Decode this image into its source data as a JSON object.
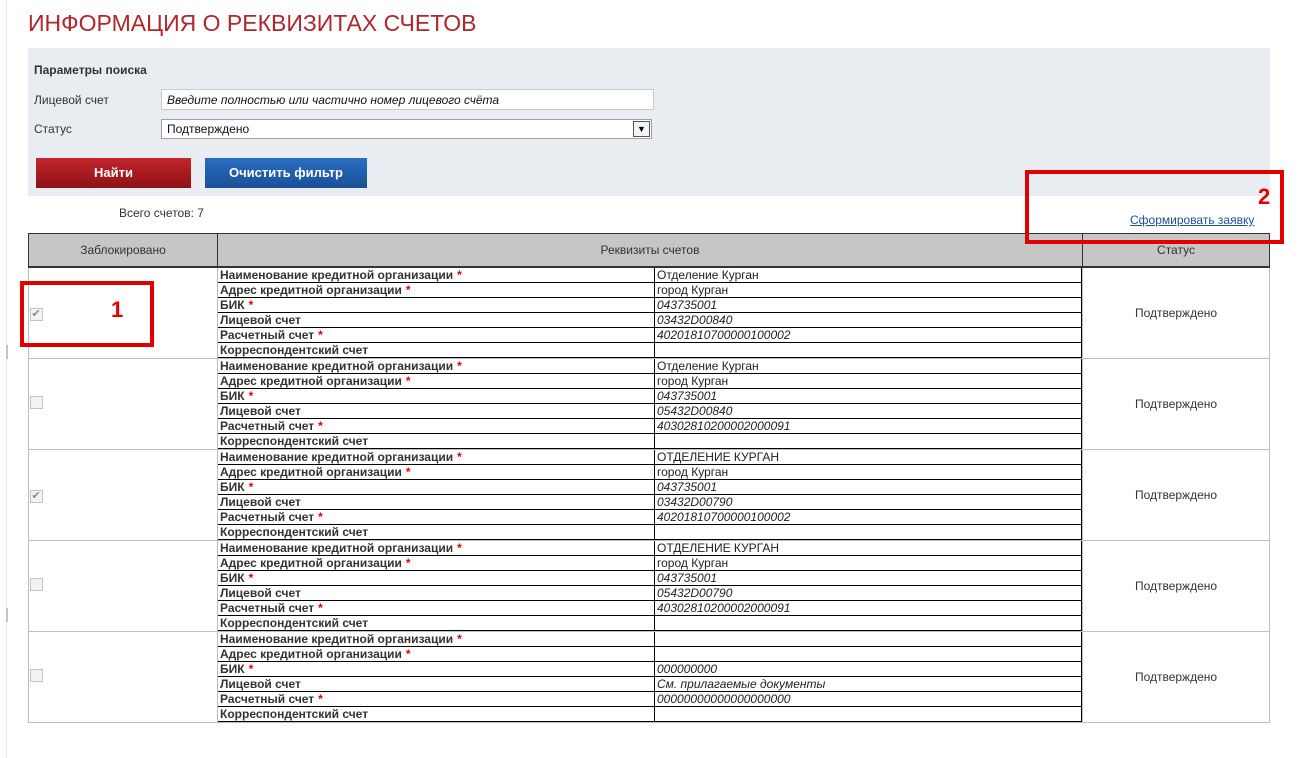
{
  "page": {
    "title": "ИНФОРМАЦИЯ О РЕКВИЗИТАХ СЧЕТОВ"
  },
  "search": {
    "heading": "Параметры поиска",
    "account_label": "Лицевой счет",
    "account_placeholder": "Введите полностью или частично номер лицевого счёта",
    "status_label": "Статус",
    "status_value": "Подтверждено",
    "find_button": "Найти",
    "clear_button": "Очистить фильтр"
  },
  "summary": {
    "total_label": "Всего счетов: 7"
  },
  "form_link": "Сформировать заявку",
  "annotations": [
    "1",
    "2"
  ],
  "table": {
    "headers": [
      "Заблокировано",
      "Реквизиты счетов",
      "Статус"
    ],
    "field_labels": {
      "org_name": "Наименование кредитной организации",
      "org_address": "Адрес кредитной организации",
      "bik": "БИК",
      "personal": "Лицевой счет",
      "settlement": "Расчетный счет",
      "corr": "Корреспондентский счет"
    },
    "required_mark": "*",
    "rows": [
      {
        "blocked": true,
        "org_name": "Отделение Курган",
        "org_address": "город Курган",
        "bik": "043735001",
        "personal": "03432D00840",
        "settlement": "40201810700000100002",
        "corr": "",
        "status": "Подтверждено"
      },
      {
        "blocked": false,
        "org_name": "Отделение Курган",
        "org_address": "город Курган",
        "bik": "043735001",
        "personal": "05432D00840",
        "settlement": "40302810200002000091",
        "corr": "",
        "status": "Подтверждено"
      },
      {
        "blocked": true,
        "org_name": "ОТДЕЛЕНИЕ КУРГАН",
        "org_address": "город Курган",
        "bik": "043735001",
        "personal": "03432D00790",
        "settlement": "40201810700000100002",
        "corr": "",
        "status": "Подтверждено"
      },
      {
        "blocked": false,
        "org_name": "ОТДЕЛЕНИЕ КУРГАН",
        "org_address": "город Курган",
        "bik": "043735001",
        "personal": "05432D00790",
        "settlement": "40302810200002000091",
        "corr": "",
        "status": "Подтверждено"
      },
      {
        "blocked": false,
        "org_name": "",
        "org_address": "",
        "bik": "000000000",
        "personal": "См. прилагаемые документы",
        "settlement": "00000000000000000000",
        "corr": "",
        "status": "Подтверждено"
      }
    ]
  },
  "colors": {
    "title": "#b0262c",
    "find_button": "#a5191e",
    "clear_button": "#1f5ca8",
    "annotation": "#e00000"
  }
}
